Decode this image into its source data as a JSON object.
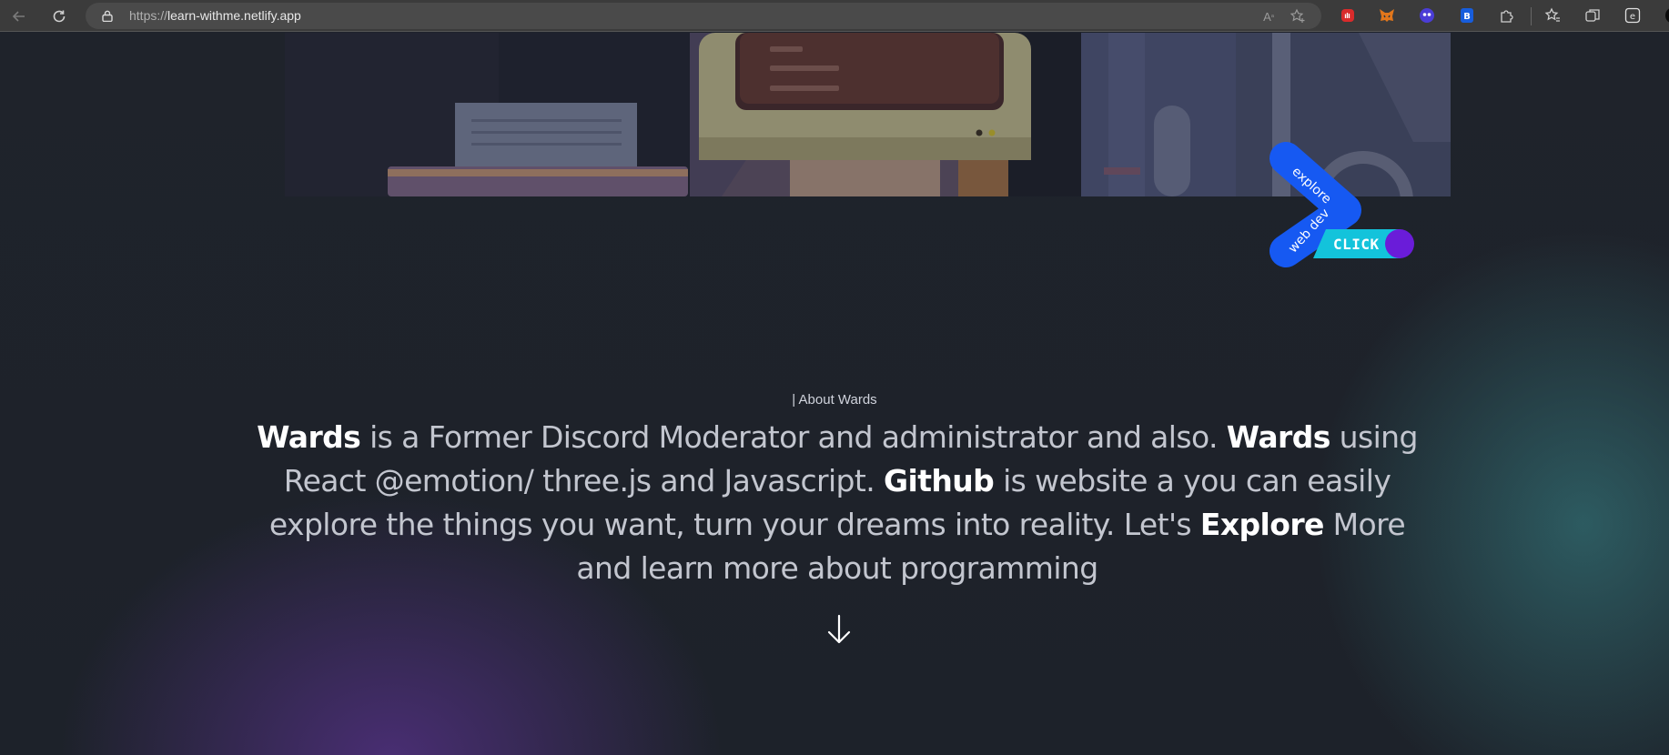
{
  "browser": {
    "url_protocol": "https://",
    "url_host": "learn-withme.netlify.app",
    "colors": {
      "chrome": "#3b3b3b",
      "address_bar": "#4a4a4a"
    },
    "extensions": [
      "shield-extension-icon",
      "metamask-fox-icon",
      "ghost-extension-icon",
      "bitwarden-icon",
      "puzzle-icon",
      "favorites-icon",
      "collections-icon",
      "edge-profile-icon"
    ]
  },
  "badge": {
    "top_text": "explore",
    "bottom_text": "web dev",
    "button_label": "CLICK",
    "colors": {
      "chevron": "#1659f2",
      "button": "#13c3db",
      "knob": "#6a1cd9"
    }
  },
  "about": {
    "tag": "| About Wards",
    "segments": [
      {
        "text": "Wards",
        "bold": true
      },
      {
        "text": " is a Former Discord Moderator and administrator and also. ",
        "bold": false
      },
      {
        "text": "Wards",
        "bold": true
      },
      {
        "text": " using React @emotion/ three.js and Javascript. ",
        "bold": false
      },
      {
        "text": "Github",
        "bold": true
      },
      {
        "text": " is website a you can easily explore the things you want, turn your dreams into reality. Let's ",
        "bold": false
      },
      {
        "text": "Explore",
        "bold": true
      },
      {
        "text": " More and learn more about programming",
        "bold": false
      }
    ]
  }
}
